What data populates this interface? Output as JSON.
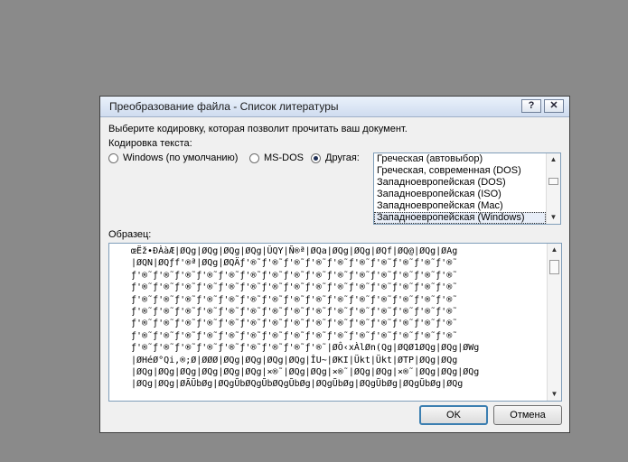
{
  "dialog": {
    "title": "Преобразование файла - Список литературы",
    "help_glyph": "?",
    "close_glyph": "✕",
    "instruction": "Выберите кодировку, которая позволит прочитать ваш документ.",
    "encoding_label": "Кодировка текста:",
    "radio_windows": "Windows (по умолчанию)",
    "radio_msdos": "MS-DOS",
    "radio_other": "Другая:",
    "selected_radio": "other",
    "encodings": [
      "Греческая (автовыбор)",
      "Греческая, современная (DOS)",
      "Западноевропейская (DOS)",
      "Западноевропейская (ISO)",
      "Западноевропейская (Mac)",
      "Западноевропейская (Windows)"
    ],
    "selected_encoding": "Западноевропейская (Windows)",
    "sample_label": "Образец:",
    "sample_lines": [
      "œËž•ÐÀàÆ|ØQg|ØQg|ØQg|ØQg|ÛQY|Ñ®ª|ØQa|ØQg|ØQg|ØQf|ØQ@|ØQg|ØAg",
      "|ØQN|ØQƒf'®ª|ØQg|ØQÄƒ'®˜ƒ'®˜ƒ'®˜ƒ'®˜ƒ'®˜ƒ'®˜ƒ'®˜ƒ'®˜ƒ'®˜ƒ'®˜",
      "ƒ'®˜ƒ'®˜ƒ'®˜ƒ'®˜ƒ'®˜ƒ'®˜ƒ'®˜ƒ'®˜ƒ'®˜ƒ'®˜ƒ'®˜ƒ'®˜ƒ'®˜ƒ'®˜ƒ'®˜",
      "ƒ'®˜ƒ'®˜ƒ'®˜ƒ'®˜ƒ'®˜ƒ'®˜ƒ'®˜ƒ'®˜ƒ'®˜ƒ'®˜ƒ'®˜ƒ'®˜ƒ'®˜ƒ'®˜ƒ'®˜",
      "ƒ'®˜ƒ'®˜ƒ'®˜ƒ'®˜ƒ'®˜ƒ'®˜ƒ'®˜ƒ'®˜ƒ'®˜ƒ'®˜ƒ'®˜ƒ'®˜ƒ'®˜ƒ'®˜ƒ'®˜",
      "ƒ'®˜ƒ'®˜ƒ'®˜ƒ'®˜ƒ'®˜ƒ'®˜ƒ'®˜ƒ'®˜ƒ'®˜ƒ'®˜ƒ'®˜ƒ'®˜ƒ'®˜ƒ'®˜ƒ'®˜",
      "ƒ'®˜ƒ'®˜ƒ'®˜ƒ'®˜ƒ'®˜ƒ'®˜ƒ'®˜ƒ'®˜ƒ'®˜ƒ'®˜ƒ'®˜ƒ'®˜ƒ'®˜ƒ'®˜ƒ'®˜",
      "ƒ'®˜ƒ'®˜ƒ'®˜ƒ'®˜ƒ'®˜ƒ'®˜ƒ'®˜ƒ'®˜ƒ'®˜ƒ'®˜ƒ'®˜ƒ'®˜ƒ'®˜ƒ'®˜ƒ'®˜",
      "ƒ'®˜ƒ'®˜ƒ'®˜ƒ'®˜ƒ'®˜ƒ'®˜ƒ'®˜ƒ'®˜ƒ'®˜|ØÔ‹xÀlØn(Qg|ØQØ1ØQg|ØQg|ØWg",
      "|ØHéØ°Qi,®;Ø|ØØØ|ØQg|ØQg|ØQg|ØQg|ÎU~|ØKI|Ükt|Ükt|ØTP|ØQg|ØQg",
      "|ØQg|ØQg|ØQg|ØQg|ØQg|ØQg|×®˜|ØQg|ØQg|×®˜|ØQg|ØQg|×®˜|ØQg|ØQg|ØQg",
      "|ØQg|ØQg|ØÃŨbØg|ØQgŨbØQgŨbØQgŨbØg|ØQgŨbØg|ØQgŨbØg|ØQgŨbØg|ØQg"
    ],
    "ok_label": "OK",
    "cancel_label": "Отмена"
  }
}
